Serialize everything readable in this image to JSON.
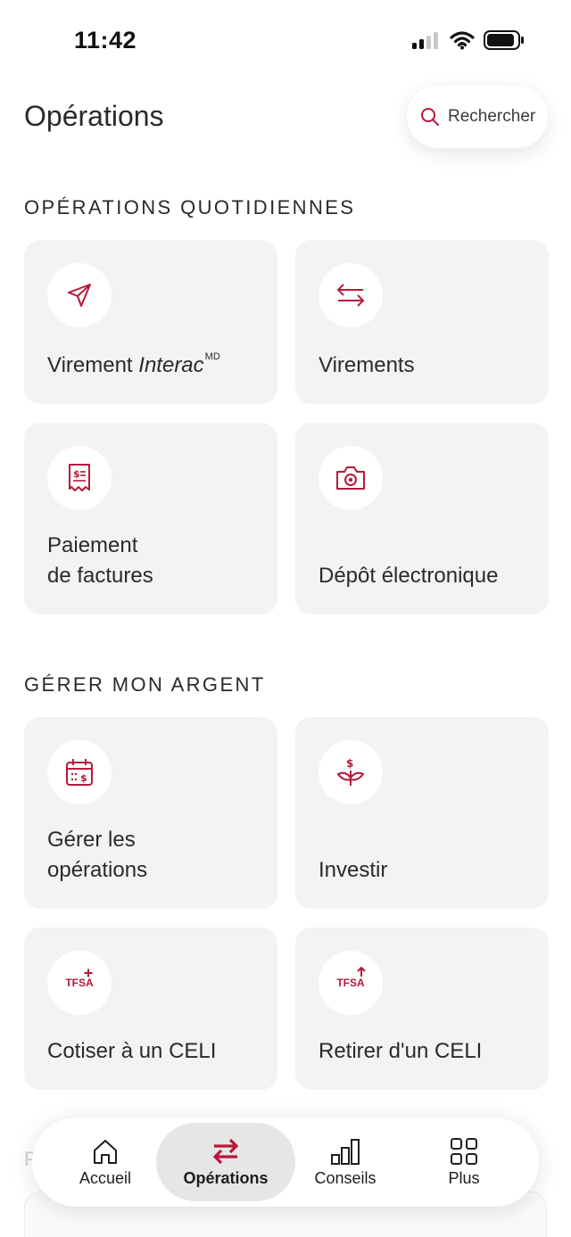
{
  "status_bar": {
    "time": "11:42"
  },
  "header": {
    "title": "Opérations",
    "search_label": "Rechercher"
  },
  "sections": {
    "daily": {
      "heading": "OPÉRATIONS QUOTIDIENNES",
      "cards": {
        "interac": {
          "label_prefix": "Virement ",
          "label_brand": "Interac",
          "label_sup": "MD",
          "icon": "paper-plane-icon"
        },
        "transfers": {
          "label": "Virements",
          "icon": "swap-arrows-icon"
        },
        "bills": {
          "line1": "Paiement",
          "line2": "de factures",
          "icon": "bill-receipt-icon"
        },
        "deposit": {
          "label": "Dépôt électronique",
          "icon": "camera-icon"
        }
      }
    },
    "manage": {
      "heading": "GÉRER MON ARGENT",
      "cards": {
        "manage_ops": {
          "line1": "Gérer les",
          "line2": "opérations",
          "icon": "calendar-dollar-icon"
        },
        "invest": {
          "label": "Investir",
          "icon": "dollar-plant-icon"
        },
        "tfsa_contribute": {
          "label": "Cotiser à un CELI",
          "badge": "TFSA",
          "icon": "tfsa-plus-icon"
        },
        "tfsa_withdraw": {
          "label": "Retirer d'un CELI",
          "badge": "TFSA",
          "icon": "tfsa-arrow-up-icon"
        }
      }
    }
  },
  "bottom_nav": {
    "items": [
      {
        "label": "Accueil",
        "icon": "home-icon"
      },
      {
        "label": "Opérations",
        "icon": "transfer-arrows-icon",
        "active": true
      },
      {
        "label": "Conseils",
        "icon": "bar-chart-icon"
      },
      {
        "label": "Plus",
        "icon": "grid-icon"
      }
    ]
  },
  "colors": {
    "accent": "#b7183a",
    "card_bg": "#f3f3f3",
    "text": "#2a2a2a"
  }
}
